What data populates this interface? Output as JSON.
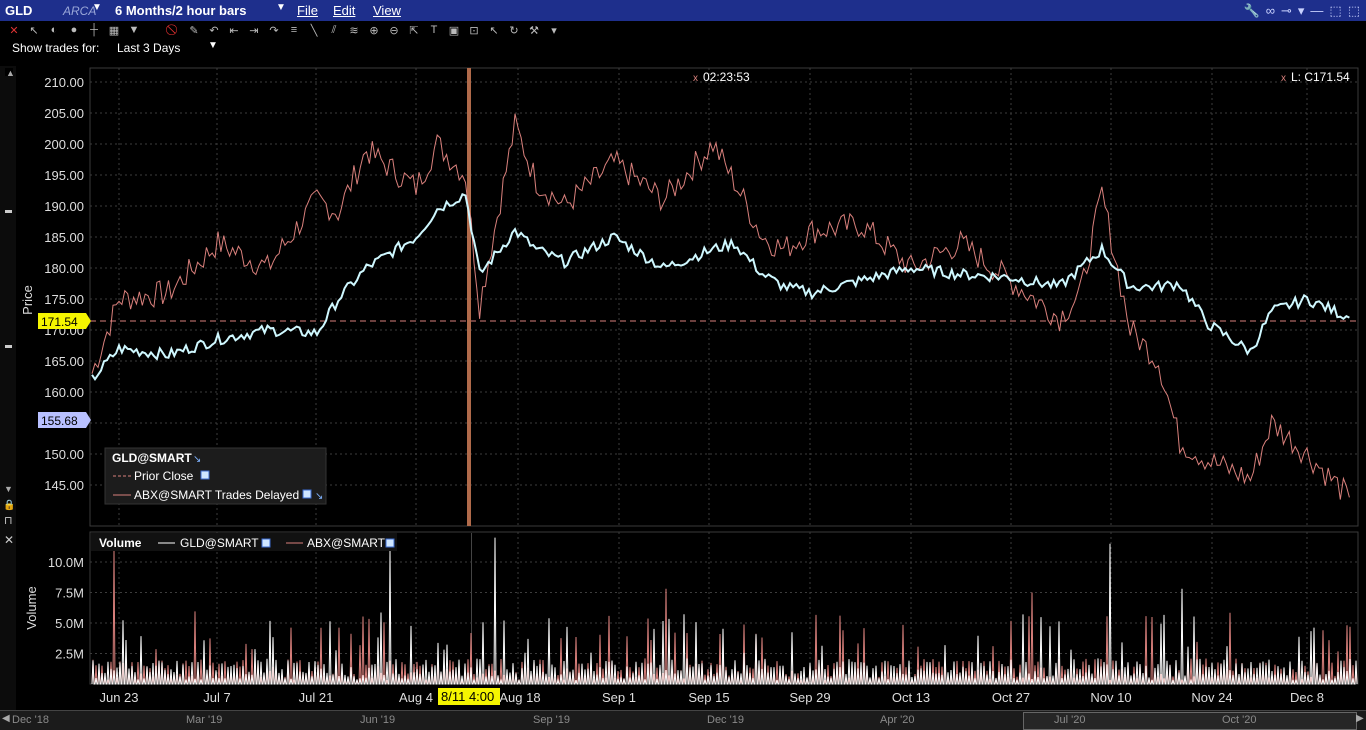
{
  "window": {
    "symbol": "GLD",
    "exchange": "ARCA",
    "period": "6 Months/2 hour bars",
    "menus": [
      "File",
      "Edit",
      "View"
    ]
  },
  "show_trades": {
    "label": "Show trades for:",
    "value": "Last 3 Days"
  },
  "crosshair": {
    "time": "02:23:53",
    "last": "L: C171.54"
  },
  "price_badges": {
    "current": "171.54",
    "secondary": "155.68"
  },
  "cursor_date": "8/11 4:00",
  "legend": {
    "title": "GLD@SMART",
    "items": [
      "Prior Close",
      "ABX@SMART Trades Delayed"
    ]
  },
  "volume_legend": {
    "title": "Volume",
    "items": [
      "GLD@SMART",
      "ABX@SMART"
    ]
  },
  "axis_titles": {
    "price": "Price",
    "volume": "Volume"
  },
  "price_ticks": [
    "210.00",
    "205.00",
    "200.00",
    "195.00",
    "190.00",
    "185.00",
    "180.00",
    "175.00",
    "170.00",
    "165.00",
    "160.00",
    "155.00",
    "150.00",
    "145.00"
  ],
  "volume_ticks": [
    "10.0M",
    "7.5M",
    "5.0M",
    "2.5M"
  ],
  "date_ticks": [
    "Jun 23",
    "Jul 7",
    "Jul 21",
    "Aug 4",
    "Aug 18",
    "Sep 1",
    "Sep 15",
    "Sep 29",
    "Oct 13",
    "Oct 27",
    "Nov 10",
    "Nov 24",
    "Dec 8"
  ],
  "scroll_labels": [
    "Dec '18",
    "Mar '19",
    "Jun '19",
    "Sep '19",
    "Dec '19",
    "Apr '20",
    "Jul '20",
    "Oct '20"
  ],
  "colors": {
    "gld": "#cff8ff",
    "abx": "#d9807c",
    "badge_current": "#f5f500",
    "badge_secondary": "#b8c0ff",
    "cursor_bar": "#b06a4a",
    "titlebar": "#1e2f8c"
  },
  "chart_data": [
    {
      "type": "line",
      "ylabel": "Price",
      "ylim": [
        140,
        212
      ],
      "grid": true,
      "series": [
        {
          "name": "GLD@SMART",
          "x": [
            "Jun 19",
            "Jun 23",
            "Jun 30",
            "Jul 7",
            "Jul 14",
            "Jul 21",
            "Jul 24",
            "Jul 28",
            "Aug 4",
            "Aug 7",
            "Aug 11",
            "Aug 13",
            "Aug 18",
            "Aug 21",
            "Aug 25",
            "Sep 1",
            "Sep 8",
            "Sep 15",
            "Sep 18",
            "Sep 22",
            "Sep 25",
            "Sep 29",
            "Oct 6",
            "Oct 13",
            "Oct 20",
            "Oct 27",
            "Nov 3",
            "Nov 6",
            "Nov 9",
            "Nov 13",
            "Nov 17",
            "Nov 20",
            "Nov 24",
            "Nov 30",
            "Dec 3",
            "Dec 8",
            "Dec 14"
          ],
          "values": [
            162,
            167,
            166,
            168.5,
            170,
            169.5,
            175,
            180,
            185,
            189.5,
            192,
            179,
            186,
            183,
            181,
            185,
            180,
            183,
            184,
            179,
            177,
            176,
            178,
            180,
            179,
            178.5,
            177,
            180,
            183,
            177,
            177,
            177.5,
            171,
            166.5,
            173,
            175,
            172
          ]
        },
        {
          "name": "ABX@SMART Trades Delayed",
          "x": [
            "Jun 19",
            "Jun 23",
            "Jun 30",
            "Jul 7",
            "Jul 14",
            "Jul 21",
            "Jul 24",
            "Jul 28",
            "Aug 4",
            "Aug 7",
            "Aug 11",
            "Aug 13",
            "Aug 18",
            "Aug 21",
            "Aug 25",
            "Sep 1",
            "Sep 8",
            "Sep 15",
            "Sep 18",
            "Sep 22",
            "Sep 25",
            "Sep 29",
            "Oct 6",
            "Oct 13",
            "Oct 20",
            "Oct 27",
            "Nov 3",
            "Nov 6",
            "Nov 9",
            "Nov 13",
            "Nov 17",
            "Nov 20",
            "Nov 24",
            "Nov 30",
            "Dec 3",
            "Dec 8",
            "Dec 14"
          ],
          "values": [
            163,
            175,
            176,
            184,
            180,
            191,
            189,
            199,
            193,
            200,
            195,
            174,
            203,
            194,
            190,
            197,
            191,
            200,
            194,
            185,
            183,
            186,
            187,
            180,
            184,
            178,
            172,
            176,
            192,
            170,
            165,
            152,
            149,
            146,
            155,
            150,
            143
          ]
        }
      ]
    },
    {
      "type": "bar",
      "ylabel": "Volume",
      "ylim": [
        0,
        12.5
      ],
      "series": [
        {
          "name": "GLD@SMART",
          "spikes": [
            {
              "x": "Jul 31",
              "value": 11.0
            },
            {
              "x": "Aug 15",
              "value": 12.0
            },
            {
              "x": "Nov 10",
              "value": 11.5
            },
            {
              "x": "Nov 20",
              "value": 7.8
            }
          ]
        },
        {
          "name": "ABX@SMART",
          "spikes": [
            {
              "x": "Jun 22",
              "value": 11.0
            },
            {
              "x": "Sep 8",
              "value": 7.8
            },
            {
              "x": "Oct 30",
              "value": 7.5
            }
          ]
        }
      ]
    }
  ]
}
